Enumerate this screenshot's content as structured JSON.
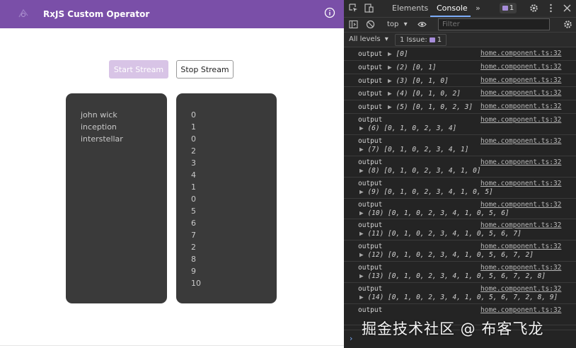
{
  "app": {
    "title": "RxJS Custom Operator",
    "start_label": "Start Stream",
    "stop_label": "Stop Stream",
    "movies": [
      "john wick",
      "inception",
      "interstellar"
    ],
    "numbers": [
      "0",
      "1",
      "0",
      "2",
      "3",
      "4",
      "1",
      "0",
      "5",
      "6",
      "7",
      "2",
      "8",
      "9",
      "10"
    ]
  },
  "devtools": {
    "tabs": [
      "Elements",
      "Console"
    ],
    "more": "»",
    "badge_count": "1",
    "context": "top",
    "filter_placeholder": "Filter",
    "levels": "All levels",
    "issues": "1 Issue:",
    "issues_count": "1",
    "logs": [
      {
        "label": "output",
        "value": "[0]",
        "source": "home.component.ts:32",
        "wrap": false
      },
      {
        "label": "output",
        "value": "(2) [0, 1]",
        "source": "home.component.ts:32",
        "wrap": false
      },
      {
        "label": "output",
        "value": "(3) [0, 1, 0]",
        "source": "home.component.ts:32",
        "wrap": false
      },
      {
        "label": "output",
        "value": "(4) [0, 1, 0, 2]",
        "source": "home.component.ts:32",
        "wrap": false
      },
      {
        "label": "output",
        "value": "(5) [0, 1, 0, 2, 3]",
        "source": "home.component.ts:32",
        "wrap": false
      },
      {
        "label": "output",
        "value": "(6) [0, 1, 0, 2, 3, 4]",
        "source": "home.component.ts:32",
        "wrap": true
      },
      {
        "label": "output",
        "value": "(7) [0, 1, 0, 2, 3, 4, 1]",
        "source": "home.component.ts:32",
        "wrap": true
      },
      {
        "label": "output",
        "value": "(8) [0, 1, 0, 2, 3, 4, 1, 0]",
        "source": "home.component.ts:32",
        "wrap": true
      },
      {
        "label": "output",
        "value": "(9) [0, 1, 0, 2, 3, 4, 1, 0, 5]",
        "source": "home.component.ts:32",
        "wrap": true
      },
      {
        "label": "output",
        "value": "(10) [0, 1, 0, 2, 3, 4, 1, 0, 5, 6]",
        "source": "home.component.ts:32",
        "wrap": true
      },
      {
        "label": "output",
        "value": "(11) [0, 1, 0, 2, 3, 4, 1, 0, 5, 6, 7]",
        "source": "home.component.ts:32",
        "wrap": true
      },
      {
        "label": "output",
        "value": "(12) [0, 1, 0, 2, 3, 4, 1, 0, 5, 6, 7, 2]",
        "source": "home.component.ts:32",
        "wrap": true
      },
      {
        "label": "output",
        "value": "(13) [0, 1, 0, 2, 3, 4, 1, 0, 5, 6, 7, 2, 8]",
        "source": "home.component.ts:32",
        "wrap": true
      },
      {
        "label": "output",
        "value": "(14) [0, 1, 0, 2, 3, 4, 1, 0, 5, 6, 7, 2, 8, 9]",
        "source": "home.component.ts:32",
        "wrap": true
      },
      {
        "label": "output",
        "value": "",
        "source": "home.component.ts:32",
        "wrap": true
      }
    ]
  },
  "watermark": "掘金技术社区 @ 布客飞龙"
}
